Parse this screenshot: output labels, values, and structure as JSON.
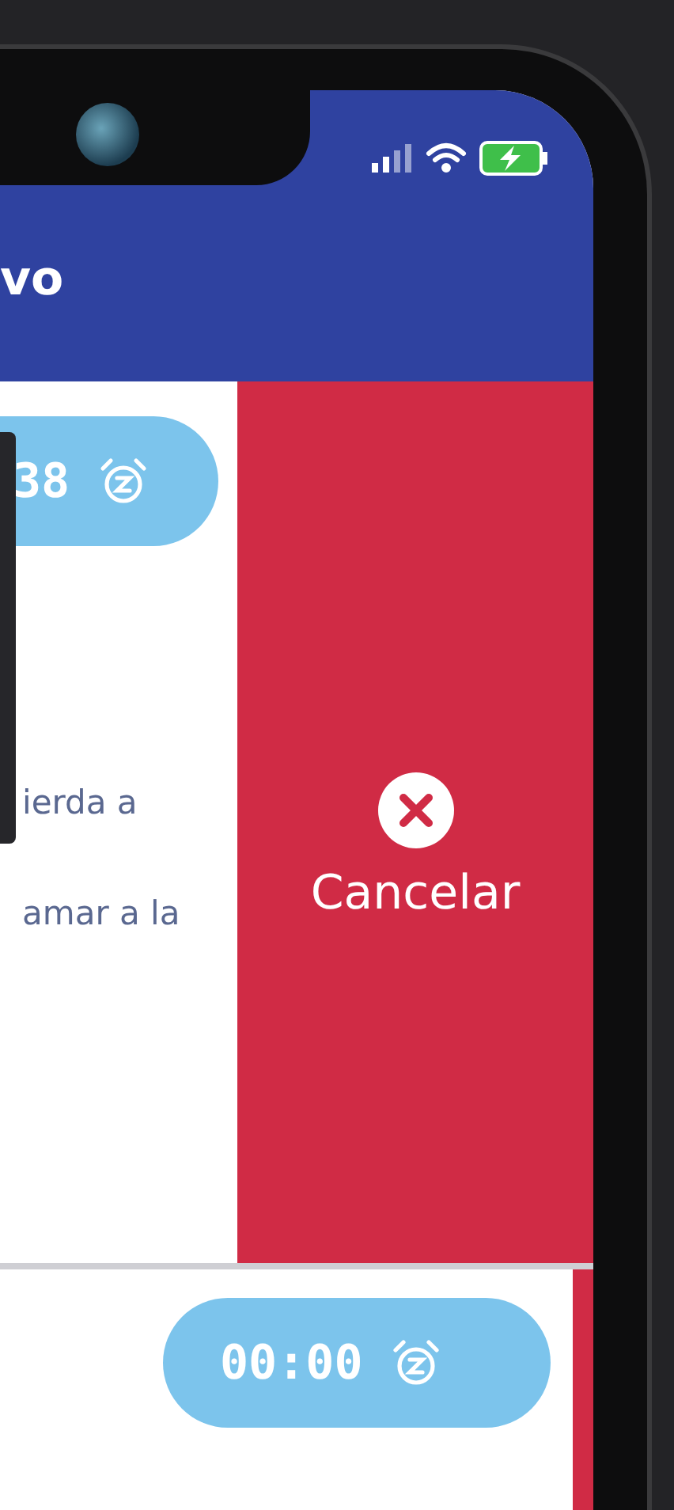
{
  "header": {
    "title": "vo"
  },
  "rows": [
    {
      "time": "38",
      "lines": [
        "ierda a",
        "amar a la"
      ],
      "action": {
        "label": "Cancelar"
      }
    },
    {
      "time": "00:00"
    }
  ]
}
